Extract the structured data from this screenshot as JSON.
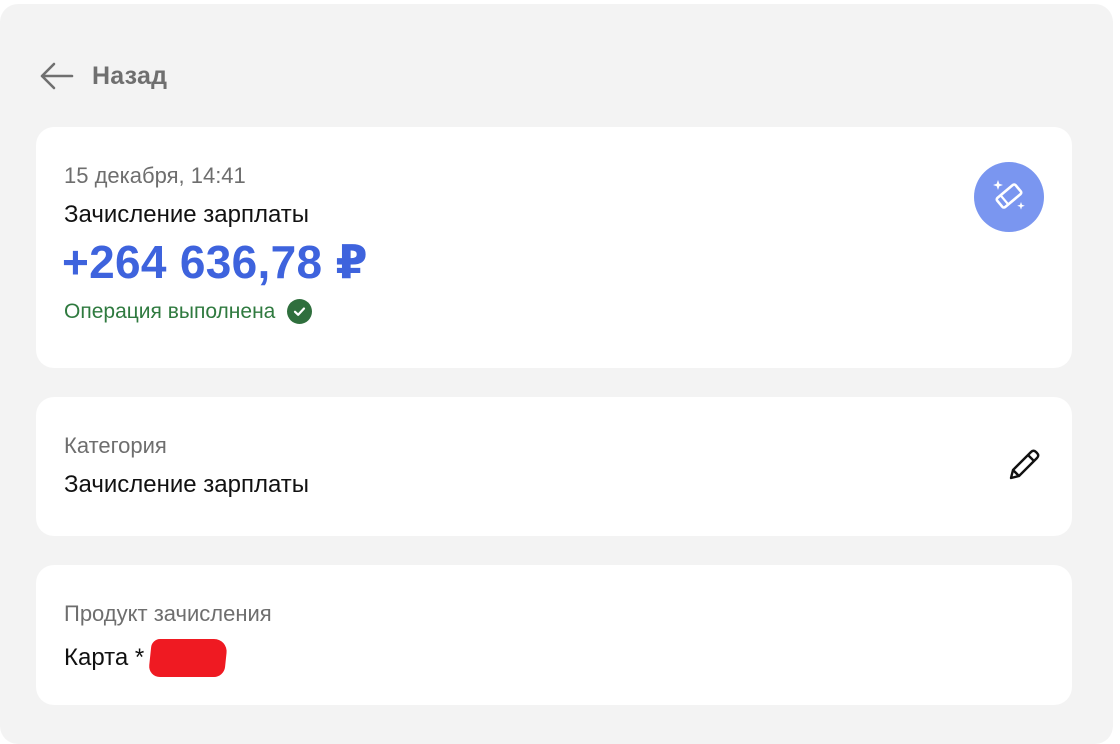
{
  "nav": {
    "back_label": "Назад",
    "back_icon": "arrow-left-icon"
  },
  "operation": {
    "date": "15 декабря, 14:41",
    "title": "Зачисление зарплаты",
    "amount": "+264 636,78 ₽",
    "status": "Операция выполнена",
    "status_icon": "check-circle-icon",
    "action_icon": "magic-wand-icon"
  },
  "category": {
    "label": "Категория",
    "value": "Зачисление зарплаты",
    "edit_icon": "pencil-icon"
  },
  "product": {
    "label": "Продукт зачисления",
    "value": "Карта *"
  },
  "colors": {
    "background": "#f3f3f3",
    "card": "#ffffff",
    "amount": "#3e63dd",
    "status": "#2f7a3f",
    "action_button": "#7a96f0",
    "redaction": "#ef1a22"
  }
}
